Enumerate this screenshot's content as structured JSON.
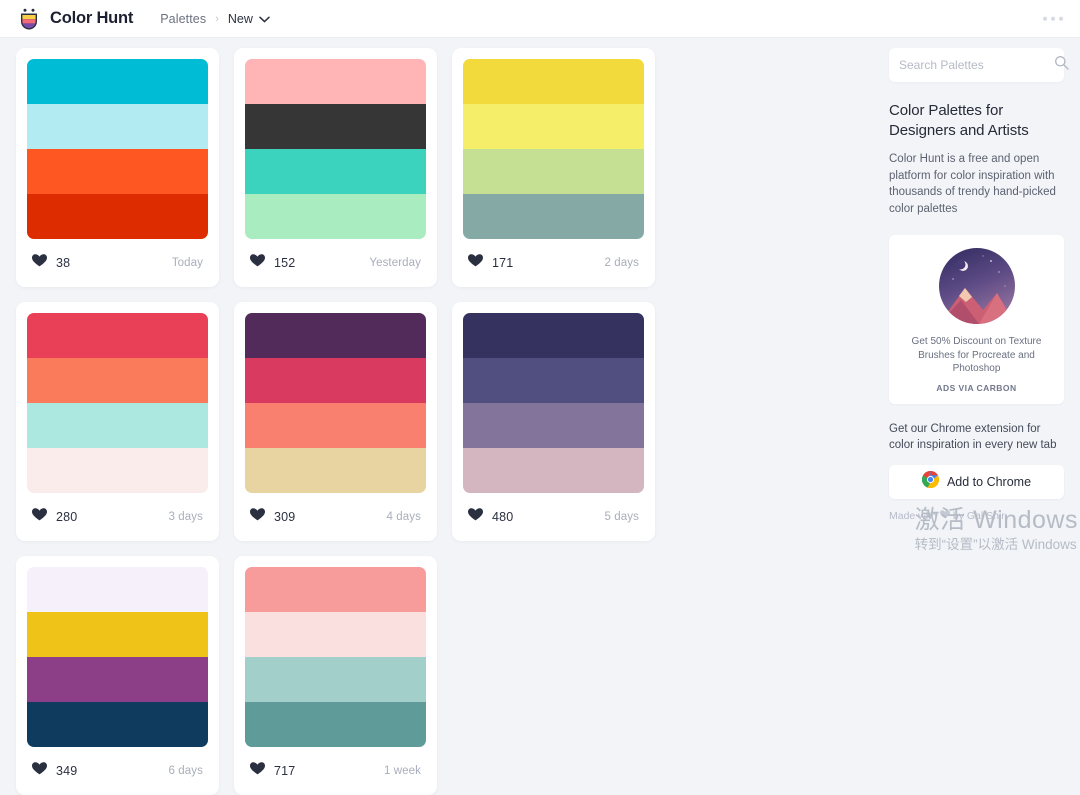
{
  "header": {
    "brand": "Color Hunt",
    "logo_icon": "colorhunt-cup-logo",
    "breadcrumb": {
      "root": "Palettes",
      "separator": "›",
      "current": "New",
      "chevron_icon": "chevron-down-icon"
    },
    "overflow_icon": "more-horizontal-icon"
  },
  "palettes": [
    {
      "colors": [
        "#00BCD4",
        "#B2EBF2",
        "#FF5722",
        "#DD2C00"
      ],
      "likes": "38",
      "date": "Today",
      "heart_icon": "heart-icon"
    },
    {
      "colors": [
        "#FFB5B5",
        "#363636",
        "#3CD3BE",
        "#A8ECC0"
      ],
      "likes": "152",
      "date": "Yesterday",
      "heart_icon": "heart-icon"
    },
    {
      "colors": [
        "#F2DA3C",
        "#F5EE68",
        "#C5DF93",
        "#85AAA5"
      ],
      "likes": "171",
      "date": "2 days",
      "heart_icon": "heart-icon"
    },
    {
      "colors": [
        "#E94057",
        "#F97B5B",
        "#ADE8E0",
        "#F9ECEB"
      ],
      "likes": "280",
      "date": "3 days",
      "heart_icon": "heart-icon"
    },
    {
      "colors": [
        "#522B5B",
        "#D83A60",
        "#F97F6E",
        "#E8D4A0"
      ],
      "likes": "309",
      "date": "4 days",
      "heart_icon": "heart-icon"
    },
    {
      "colors": [
        "#353260",
        "#514E80",
        "#82749B",
        "#D3B6C0"
      ],
      "likes": "480",
      "date": "5 days",
      "heart_icon": "heart-icon"
    },
    {
      "colors": [
        "#F5F0FA",
        "#F0C319",
        "#8C3F86",
        "#0F3C5E"
      ],
      "likes": "349",
      "date": "6 days",
      "heart_icon": "heart-icon"
    },
    {
      "colors": [
        "#F89B9B",
        "#FBE0E0",
        "#A3CFCB",
        "#5E9B99"
      ],
      "likes": "717",
      "date": "1 week",
      "heart_icon": "heart-icon"
    }
  ],
  "sidebar": {
    "search": {
      "placeholder": "Search Palettes",
      "value": "",
      "icon": "search-icon"
    },
    "title": "Color Palettes for Designers and Artists",
    "description": "Color Hunt is a free and open platform for color inspiration with thousands of trendy hand-picked color palettes",
    "ad": {
      "image_icon": "night-mountain-illustration",
      "text": "Get 50% Discount on Texture Brushes for Procreate and Photoshop",
      "via": "ADS VIA CARBON"
    },
    "chrome": {
      "text": "Get our Chrome extension for color inspiration in every new tab",
      "button_label": "Add to Chrome",
      "button_icon": "chrome-logo-icon"
    },
    "made_by": {
      "prefix": "Made with",
      "heart_icon": "heart-icon",
      "suffix": "by Gal Shir"
    }
  },
  "watermark": {
    "line1": "激活 Windows",
    "line2": "转到“设置”以激活 Windows"
  }
}
